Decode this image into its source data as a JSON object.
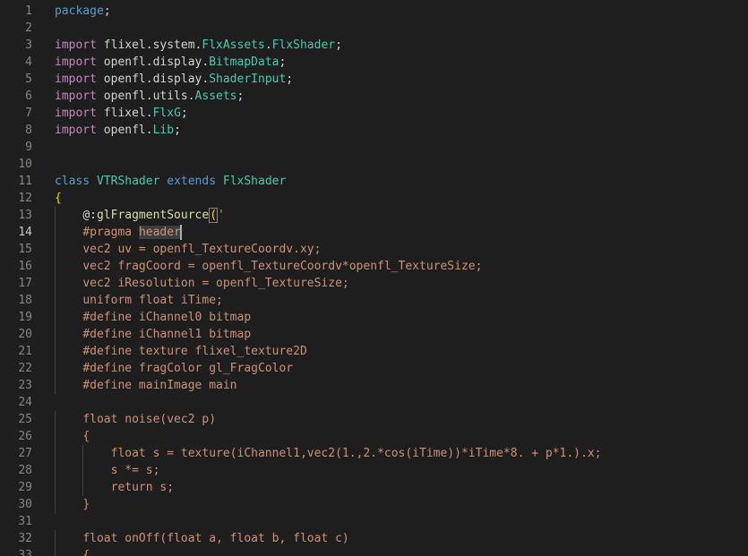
{
  "colors": {
    "background": "#1e1e1e",
    "line_number": "#858585",
    "line_number_active": "#c6c6c6",
    "keyword_blue": "#569cd6",
    "keyword_purple": "#c586c0",
    "type_teal": "#4ec9b0",
    "function_yellow": "#dcdcaa",
    "string_orange": "#ce9178",
    "text": "#d4d4d4"
  },
  "editor": {
    "active_line": 14,
    "lines": [
      {
        "n": "1",
        "tokens": [
          {
            "t": "kw",
            "v": "package"
          },
          {
            "t": "txt",
            "v": ";"
          }
        ]
      },
      {
        "n": "2",
        "tokens": []
      },
      {
        "n": "3",
        "tokens": [
          {
            "t": "ctl",
            "v": "import"
          },
          {
            "t": "txt",
            "v": " flixel.system."
          },
          {
            "t": "type",
            "v": "FlxAssets"
          },
          {
            "t": "txt",
            "v": "."
          },
          {
            "t": "type",
            "v": "FlxShader"
          },
          {
            "t": "txt",
            "v": ";"
          }
        ]
      },
      {
        "n": "4",
        "tokens": [
          {
            "t": "ctl",
            "v": "import"
          },
          {
            "t": "txt",
            "v": " openfl.display."
          },
          {
            "t": "type",
            "v": "BitmapData"
          },
          {
            "t": "txt",
            "v": ";"
          }
        ]
      },
      {
        "n": "5",
        "tokens": [
          {
            "t": "ctl",
            "v": "import"
          },
          {
            "t": "txt",
            "v": " openfl.display."
          },
          {
            "t": "type",
            "v": "ShaderInput"
          },
          {
            "t": "txt",
            "v": ";"
          }
        ]
      },
      {
        "n": "6",
        "tokens": [
          {
            "t": "ctl",
            "v": "import"
          },
          {
            "t": "txt",
            "v": " openfl.utils."
          },
          {
            "t": "type",
            "v": "Assets"
          },
          {
            "t": "txt",
            "v": ";"
          }
        ]
      },
      {
        "n": "7",
        "tokens": [
          {
            "t": "ctl",
            "v": "import"
          },
          {
            "t": "txt",
            "v": " flixel."
          },
          {
            "t": "type",
            "v": "FlxG"
          },
          {
            "t": "txt",
            "v": ";"
          }
        ]
      },
      {
        "n": "8",
        "tokens": [
          {
            "t": "ctl",
            "v": "import"
          },
          {
            "t": "txt",
            "v": " openfl."
          },
          {
            "t": "type",
            "v": "Lib"
          },
          {
            "t": "txt",
            "v": ";"
          }
        ]
      },
      {
        "n": "9",
        "tokens": []
      },
      {
        "n": "10",
        "tokens": []
      },
      {
        "n": "11",
        "tokens": [
          {
            "t": "kw",
            "v": "class"
          },
          {
            "t": "txt",
            "v": " "
          },
          {
            "t": "type",
            "v": "VTRShader"
          },
          {
            "t": "txt",
            "v": " "
          },
          {
            "t": "kw",
            "v": "extends"
          },
          {
            "t": "txt",
            "v": " "
          },
          {
            "t": "type",
            "v": "FlxShader"
          }
        ]
      },
      {
        "n": "12",
        "tokens": [
          {
            "t": "brace",
            "v": "{"
          }
        ]
      },
      {
        "n": "13",
        "tokens": [
          {
            "t": "txt",
            "v": "    "
          },
          {
            "t": "txt",
            "v": "@:"
          },
          {
            "t": "fn",
            "v": "glFragmentSource"
          },
          {
            "t": "bracehl",
            "v": "("
          },
          {
            "t": "str",
            "v": "'"
          }
        ]
      },
      {
        "n": "14",
        "tokens": [
          {
            "t": "txt",
            "v": "    "
          },
          {
            "t": "str",
            "v": "#pragma "
          },
          {
            "t": "sel",
            "v": "header"
          },
          {
            "t": "cursor",
            "v": ""
          }
        ]
      },
      {
        "n": "15",
        "tokens": [
          {
            "t": "txt",
            "v": "    "
          },
          {
            "t": "str",
            "v": "vec2 uv = openfl_TextureCoordv.xy;"
          }
        ]
      },
      {
        "n": "16",
        "tokens": [
          {
            "t": "txt",
            "v": "    "
          },
          {
            "t": "str",
            "v": "vec2 fragCoord = openfl_TextureCoordv*openfl_TextureSize;"
          }
        ]
      },
      {
        "n": "17",
        "tokens": [
          {
            "t": "txt",
            "v": "    "
          },
          {
            "t": "str",
            "v": "vec2 iResolution = openfl_TextureSize;"
          }
        ]
      },
      {
        "n": "18",
        "tokens": [
          {
            "t": "txt",
            "v": "    "
          },
          {
            "t": "str",
            "v": "uniform float iTime;"
          }
        ]
      },
      {
        "n": "19",
        "tokens": [
          {
            "t": "txt",
            "v": "    "
          },
          {
            "t": "str",
            "v": "#define iChannel0 bitmap"
          }
        ]
      },
      {
        "n": "20",
        "tokens": [
          {
            "t": "txt",
            "v": "    "
          },
          {
            "t": "str",
            "v": "#define iChannel1 bitmap"
          }
        ]
      },
      {
        "n": "21",
        "tokens": [
          {
            "t": "txt",
            "v": "    "
          },
          {
            "t": "str",
            "v": "#define texture flixel_texture2D"
          }
        ]
      },
      {
        "n": "22",
        "tokens": [
          {
            "t": "txt",
            "v": "    "
          },
          {
            "t": "str",
            "v": "#define fragColor gl_FragColor"
          }
        ]
      },
      {
        "n": "23",
        "tokens": [
          {
            "t": "txt",
            "v": "    "
          },
          {
            "t": "str",
            "v": "#define mainImage main"
          }
        ]
      },
      {
        "n": "24",
        "tokens": []
      },
      {
        "n": "25",
        "tokens": [
          {
            "t": "txt",
            "v": "    "
          },
          {
            "t": "str",
            "v": "float noise(vec2 p)"
          }
        ]
      },
      {
        "n": "26",
        "tokens": [
          {
            "t": "txt",
            "v": "    "
          },
          {
            "t": "str",
            "v": "{"
          }
        ]
      },
      {
        "n": "27",
        "tokens": [
          {
            "t": "txt",
            "v": "        "
          },
          {
            "t": "str",
            "v": "float s = texture(iChannel1,vec2(1.,2.*cos(iTime))*iTime*8. + p*1.).x;"
          }
        ]
      },
      {
        "n": "28",
        "tokens": [
          {
            "t": "txt",
            "v": "        "
          },
          {
            "t": "str",
            "v": "s *= s;"
          }
        ]
      },
      {
        "n": "29",
        "tokens": [
          {
            "t": "txt",
            "v": "        "
          },
          {
            "t": "str",
            "v": "return s;"
          }
        ]
      },
      {
        "n": "30",
        "tokens": [
          {
            "t": "txt",
            "v": "    "
          },
          {
            "t": "str",
            "v": "}"
          }
        ]
      },
      {
        "n": "31",
        "tokens": []
      },
      {
        "n": "32",
        "tokens": [
          {
            "t": "txt",
            "v": "    "
          },
          {
            "t": "str",
            "v": "float onOff(float a, float b, float c)"
          }
        ]
      },
      {
        "n": "33",
        "tokens": [
          {
            "t": "txt",
            "v": "    "
          },
          {
            "t": "str",
            "v": "{"
          }
        ]
      }
    ]
  }
}
